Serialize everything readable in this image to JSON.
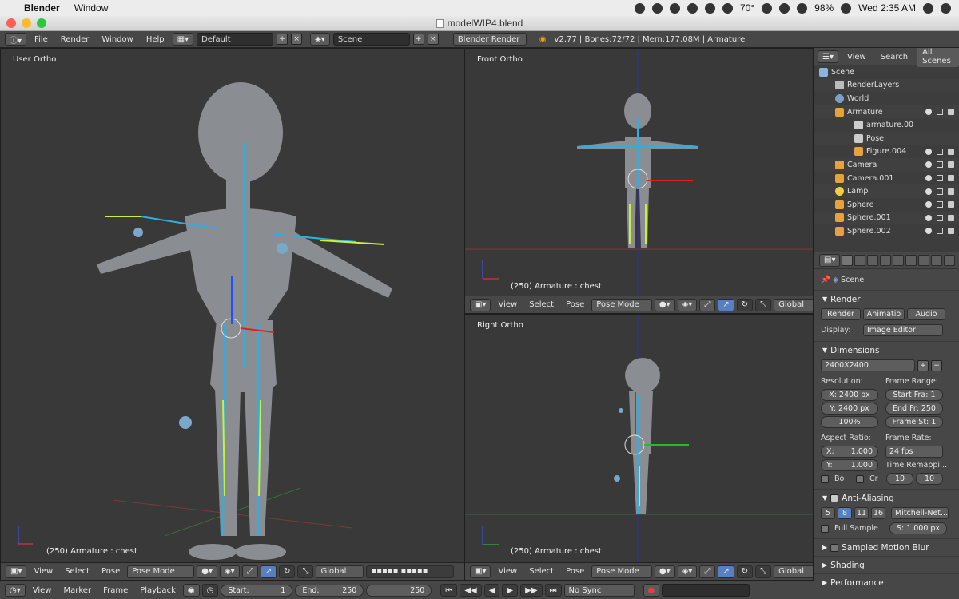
{
  "os_menubar": {
    "app": "Blender",
    "menus": [
      "Window"
    ],
    "temperature": "70°",
    "battery": "98%",
    "clock": "Wed 2:35 AM"
  },
  "window": {
    "title": "modelWIP4.blend"
  },
  "info_header": {
    "menus": [
      "File",
      "Render",
      "Window",
      "Help"
    ],
    "screen_layout": "Default",
    "scene": "Scene",
    "engine": "Blender Render",
    "stats": "v2.77 | Bones:72/72 | Mem:177.08M | Armature"
  },
  "viewports": {
    "user": {
      "title": "User Ortho",
      "frame_info": "(250) Armature : chest"
    },
    "front": {
      "title": "Front Ortho",
      "frame_info": "(250) Armature : chest"
    },
    "right": {
      "title": "Right Ortho",
      "frame_info": "(250) Armature : chest"
    },
    "header": {
      "view": "View",
      "select": "Select",
      "pose": "Pose",
      "mode": "Pose Mode",
      "orientation": "Global"
    }
  },
  "outliner": {
    "tabs": [
      "View",
      "Search",
      "All Scenes"
    ],
    "items": [
      {
        "label": "Scene",
        "indent": 0
      },
      {
        "label": "RenderLayers",
        "indent": 1
      },
      {
        "label": "World",
        "indent": 1
      },
      {
        "label": "Armature",
        "indent": 1
      },
      {
        "label": "armature.00",
        "indent": 2
      },
      {
        "label": "Pose",
        "indent": 2
      },
      {
        "label": "Figure.004",
        "indent": 2
      },
      {
        "label": "Camera",
        "indent": 1
      },
      {
        "label": "Camera.001",
        "indent": 1
      },
      {
        "label": "Lamp",
        "indent": 1
      },
      {
        "label": "Sphere",
        "indent": 1
      },
      {
        "label": "Sphere.001",
        "indent": 1
      },
      {
        "label": "Sphere.002",
        "indent": 1
      }
    ]
  },
  "properties": {
    "context": "Scene",
    "render_panel": {
      "title": "Render",
      "buttons": [
        "Render",
        "Animatio",
        "Audio"
      ],
      "display_label": "Display:",
      "display_value": "Image Editor"
    },
    "dimensions_panel": {
      "title": "Dimensions",
      "preset": "2400X2400",
      "resolution_label": "Resolution:",
      "res_x": "X: 2400 px",
      "res_y": "Y: 2400 px",
      "res_pct": "100%",
      "frame_range_label": "Frame Range:",
      "start": "Start Fra: 1",
      "end": "End Fr: 250",
      "step": "Frame St: 1",
      "aspect_label": "Aspect Ratio:",
      "aspect_x": "X:",
      "aspect_x_val": "1.000",
      "aspect_y": "Y:",
      "aspect_y_val": "1.000",
      "frame_rate_label": "Frame Rate:",
      "fps": "24 fps",
      "bo": "Bo",
      "cr": "Cr",
      "remap_label": "Time Remappi...",
      "remap_old": "10",
      "remap_new": "10"
    },
    "aa_panel": {
      "title": "Anti-Aliasing",
      "samples": [
        "5",
        "8",
        "11",
        "16"
      ],
      "filter": "Mitchell-Net...",
      "full_sample": "Full Sample",
      "size": "S: 1.000 px"
    },
    "motion_blur": "Sampled Motion Blur",
    "shading": "Shading",
    "performance": "Performance"
  },
  "timeline": {
    "view": "View",
    "marker": "Marker",
    "frame": "Frame",
    "playback": "Playback",
    "start_label": "Start:",
    "start_value": "1",
    "end_label": "End:",
    "end_value": "250",
    "current": "250",
    "sync": "No Sync"
  },
  "colors": {
    "viewport_bg": "#393939",
    "header_bg": "#474747",
    "bone": "#2ab0e6",
    "bone_selected": "#c8f03c",
    "accent_blue": "#5680c2"
  }
}
